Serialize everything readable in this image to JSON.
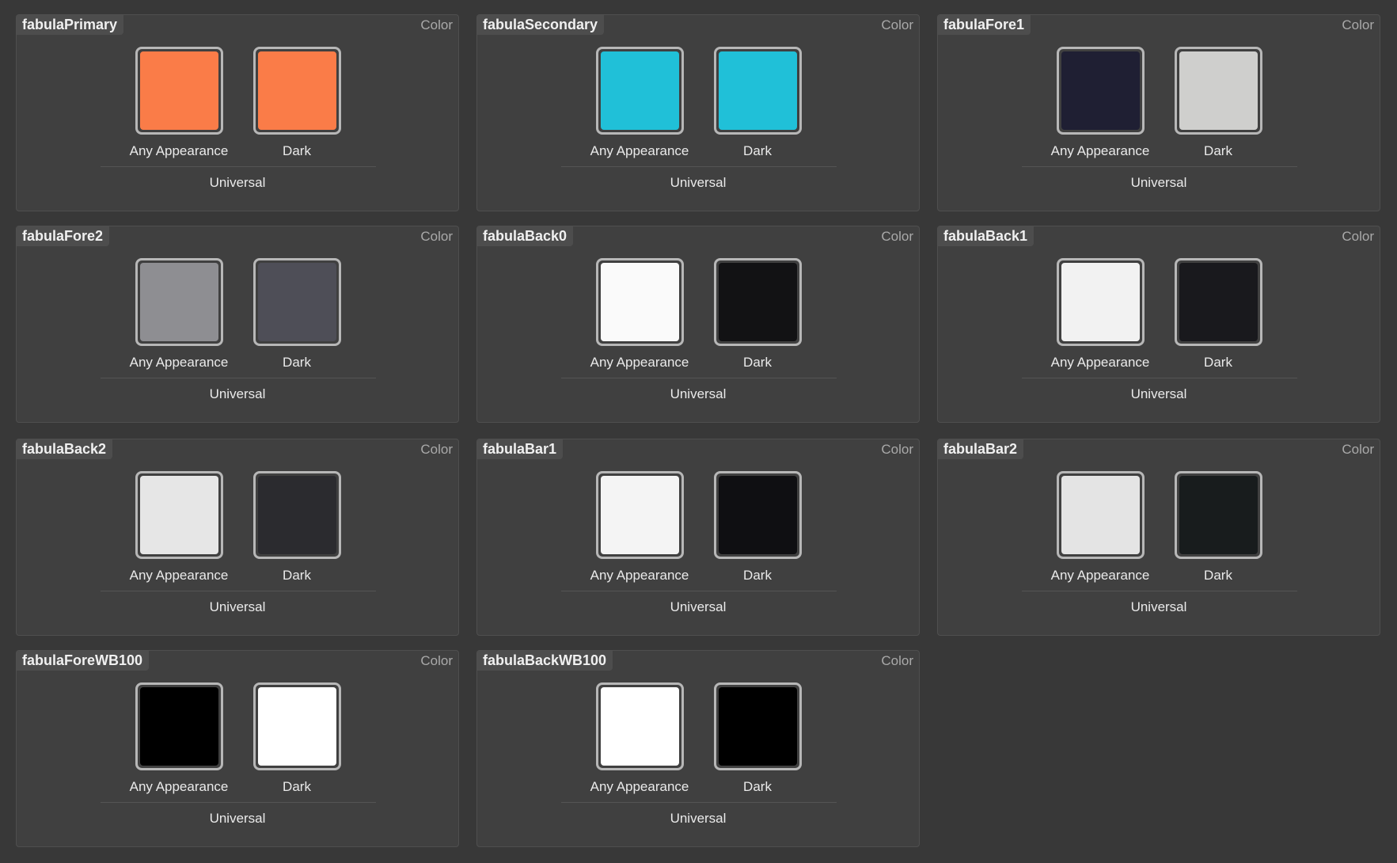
{
  "common": {
    "type_label": "Color",
    "any_label": "Any Appearance",
    "dark_label": "Dark",
    "idiom_label": "Universal"
  },
  "colors": [
    {
      "name": "fabulaPrimary",
      "any": "#FA7C48",
      "dark": "#FA7C48"
    },
    {
      "name": "fabulaSecondary",
      "any": "#20C0D8",
      "dark": "#20C0D8"
    },
    {
      "name": "fabulaFore1",
      "any": "#1F1F33",
      "dark": "#CFCFCD"
    },
    {
      "name": "fabulaFore2",
      "any": "#8E8E92",
      "dark": "#4E4E57"
    },
    {
      "name": "fabulaBack0",
      "any": "#FAFAFA",
      "dark": "#121214"
    },
    {
      "name": "fabulaBack1",
      "any": "#F2F2F2",
      "dark": "#19191D"
    },
    {
      "name": "fabulaBack2",
      "any": "#E6E6E6",
      "dark": "#2B2B2F"
    },
    {
      "name": "fabulaBar1",
      "any": "#F4F4F4",
      "dark": "#0F0F12"
    },
    {
      "name": "fabulaBar2",
      "any": "#E4E4E4",
      "dark": "#181C1D"
    },
    {
      "name": "fabulaForeWB100",
      "any": "#000000",
      "dark": "#FFFFFF"
    },
    {
      "name": "fabulaBackWB100",
      "any": "#FFFFFF",
      "dark": "#000000"
    }
  ]
}
